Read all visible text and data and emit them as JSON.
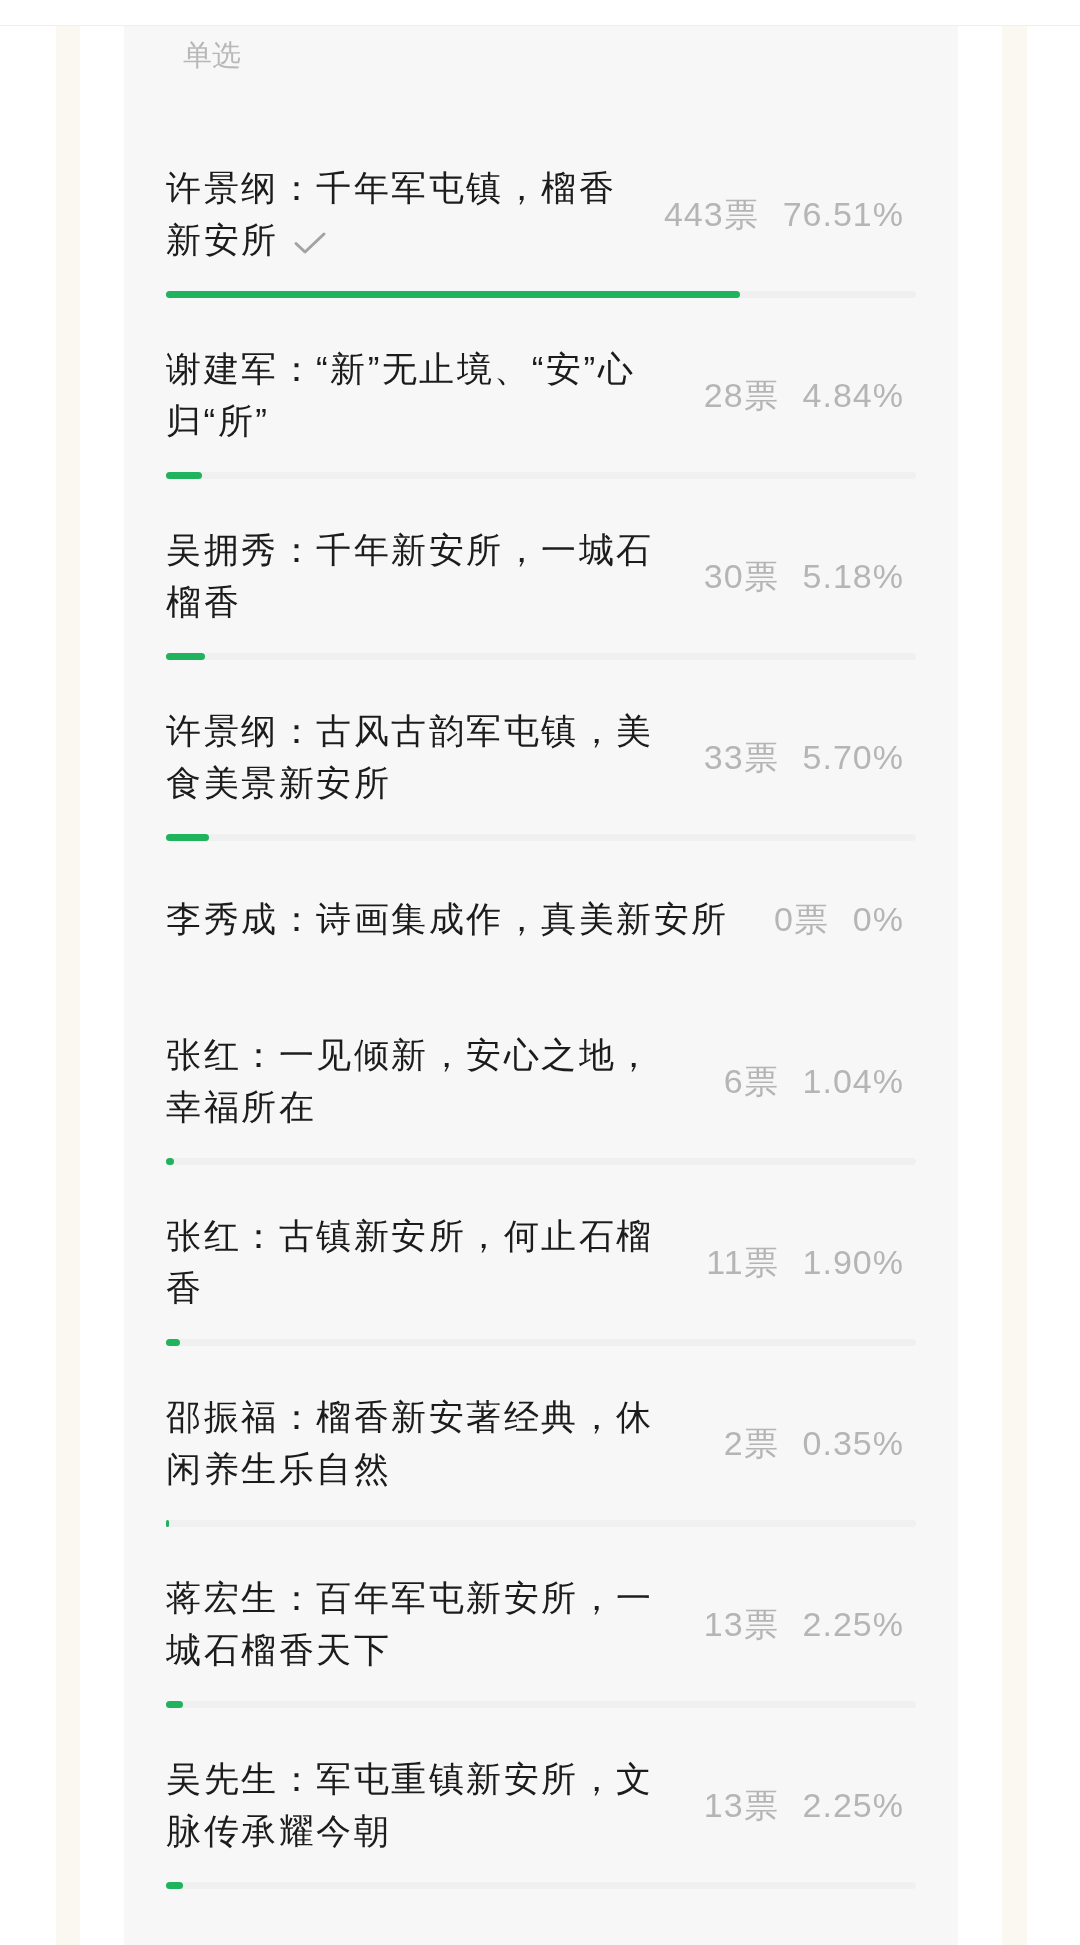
{
  "poll": {
    "choice_type": "单选",
    "options": [
      {
        "text": "许景纲：千年军屯镇，榴香新安所",
        "selected": true,
        "votes": "443票",
        "percent": "76.51%",
        "level": 0.7651
      },
      {
        "text": "谢建军：“新”无止境、“安”心归“所”",
        "selected": false,
        "votes": "28票",
        "percent": "4.84%",
        "level": 0.0484
      },
      {
        "text": "吴拥秀：千年新安所，一城石榴香",
        "selected": false,
        "votes": "30票",
        "percent": "5.18%",
        "level": 0.0518
      },
      {
        "text": "许景纲：古风古韵军屯镇，美食美景新安所",
        "selected": false,
        "votes": "33票",
        "percent": "5.70%",
        "level": 0.057
      },
      {
        "text": "李秀成：诗画集成作，真美新安所",
        "selected": false,
        "votes": "0票",
        "percent": "0%"
      },
      {
        "text": "张红：一见倾新，安心之地，幸福所在",
        "selected": false,
        "votes": "6票",
        "percent": "1.04%",
        "level": 0.0104
      },
      {
        "text": "张红：古镇新安所，何止石榴香",
        "selected": false,
        "votes": "11票",
        "percent": "1.90%",
        "level": 0.019
      },
      {
        "text": "邵振福：榴香新安著经典，休闲养生乐自然",
        "selected": false,
        "votes": "2票",
        "percent": "0.35%",
        "level": 0.0035
      },
      {
        "text": "蒋宏生：百年军屯新安所，一城石榴香天下",
        "selected": false,
        "votes": "13票",
        "percent": "2.25%",
        "level": 0.0225
      },
      {
        "text": "吴先生：军屯重镇新安所，文脉传承耀今朝",
        "selected": false,
        "votes": "13票",
        "percent": "2.25%",
        "level": 0.0225
      }
    ]
  }
}
